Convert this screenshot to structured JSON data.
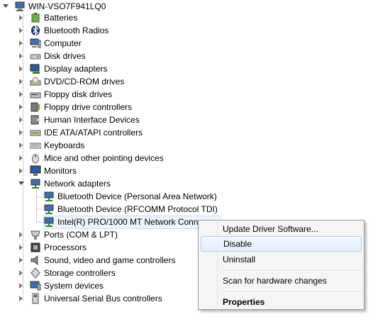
{
  "tree": {
    "root": "WIN-VSO7F941LQ0",
    "categories": [
      {
        "label": "Batteries",
        "icon": "battery-icon"
      },
      {
        "label": "Bluetooth Radios",
        "icon": "bluetooth-icon"
      },
      {
        "label": "Computer",
        "icon": "computer-icon"
      },
      {
        "label": "Disk drives",
        "icon": "disk-drive-icon"
      },
      {
        "label": "Display adapters",
        "icon": "display-adapter-icon"
      },
      {
        "label": "DVD/CD-ROM drives",
        "icon": "dvd-drive-icon"
      },
      {
        "label": "Floppy disk drives",
        "icon": "floppy-drive-icon"
      },
      {
        "label": "Floppy drive controllers",
        "icon": "floppy-controller-icon"
      },
      {
        "label": "Human Interface Devices",
        "icon": "hid-icon"
      },
      {
        "label": "IDE ATA/ATAPI controllers",
        "icon": "ide-controller-icon"
      },
      {
        "label": "Keyboards",
        "icon": "keyboard-icon"
      },
      {
        "label": "Mice and other pointing devices",
        "icon": "mouse-icon"
      },
      {
        "label": "Monitors",
        "icon": "monitor-icon"
      },
      {
        "label": "Network adapters",
        "icon": "network-adapter-icon"
      },
      {
        "label": "Ports (COM & LPT)",
        "icon": "port-icon"
      },
      {
        "label": "Processors",
        "icon": "processor-icon"
      },
      {
        "label": "Sound, video and game controllers",
        "icon": "sound-icon"
      },
      {
        "label": "Storage controllers",
        "icon": "storage-controller-icon"
      },
      {
        "label": "System devices",
        "icon": "system-device-icon"
      },
      {
        "label": "Universal Serial Bus controllers",
        "icon": "usb-icon"
      }
    ],
    "network_children": [
      "Bluetooth Device (Personal Area Network)",
      "Bluetooth Device (RFCOMM Protocol TDI)",
      "Intel(R) PRO/1000 MT Network Conne"
    ]
  },
  "context_menu": {
    "items": [
      {
        "label": "Update Driver Software..."
      },
      {
        "label": "Disable",
        "highlighted": true
      },
      {
        "label": "Uninstall"
      },
      {
        "label": "Scan for hardware changes"
      },
      {
        "label": "Properties",
        "bold": true
      }
    ]
  },
  "colors": {
    "selection": "#eef4fc",
    "menu_highlight": "#e4eefb",
    "menu_bg": "#f5f5f5"
  }
}
